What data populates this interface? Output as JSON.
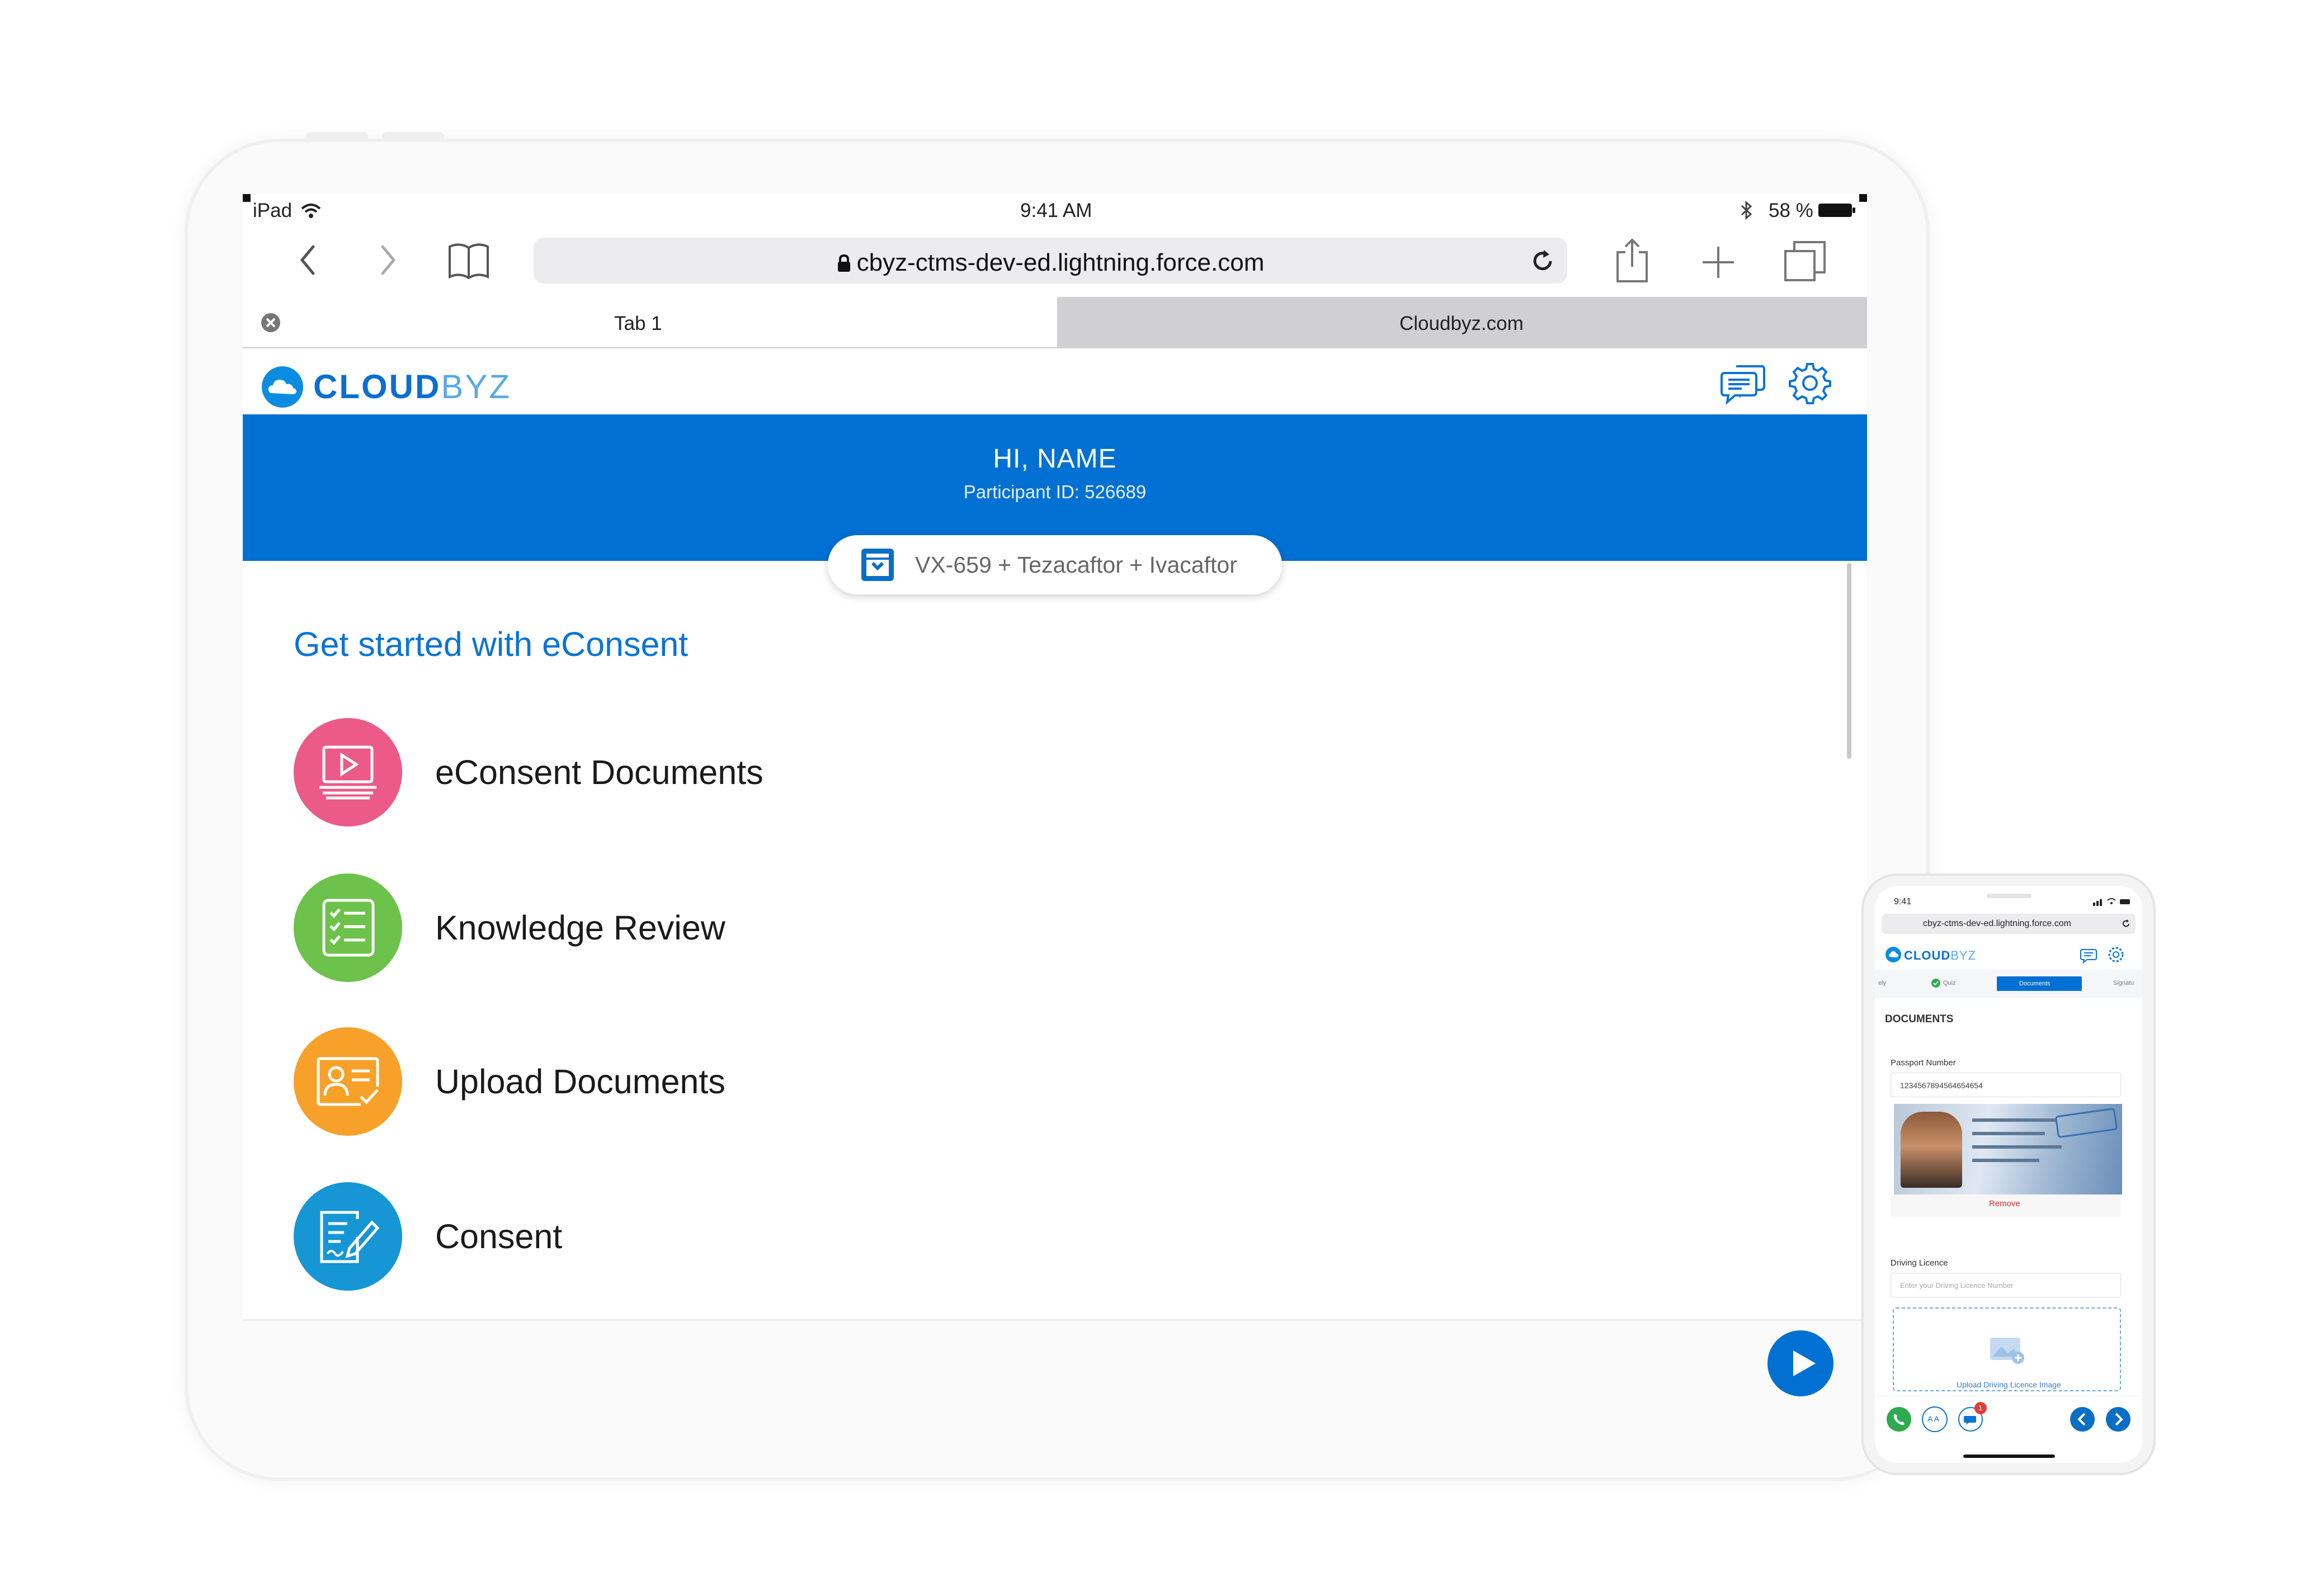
{
  "status_bar": {
    "device": "iPad",
    "time": "9:41 AM",
    "battery": "58 %"
  },
  "browser": {
    "url": "cbyz-ctms-dev-ed.lightning.force.com",
    "tabs": [
      {
        "label": "Tab 1"
      },
      {
        "label": "Cloudbyz.com"
      }
    ]
  },
  "app": {
    "logo_bold": "CLOUD",
    "logo_light": "BYZ",
    "greeting": "HI, NAME",
    "participant_id": "Participant ID: 526689",
    "study": "VX-659 + Tezacaftor + Ivacaftor",
    "section_title": "Get started with eConsent",
    "items": [
      {
        "label": "eConsent Documents",
        "color": "#ec5a8a",
        "icon": "video-document-icon"
      },
      {
        "label": "Knowledge Review",
        "color": "#6cc24a",
        "icon": "checklist-icon"
      },
      {
        "label": "Upload Documents",
        "color": "#f7a12a",
        "icon": "id-card-icon"
      },
      {
        "label": "Consent",
        "color": "#1696d4",
        "icon": "sign-document-icon"
      }
    ]
  },
  "phone": {
    "time": "9:41",
    "url": "cbyz-ctms-dev-ed.lightning.force.com",
    "logo_bold": "CLOUD",
    "logo_light": "BYZ",
    "steps": [
      "ely",
      "Quiz",
      "Documents",
      "Signatu"
    ],
    "section": "DOCUMENTS",
    "passport_label": "Passport Number",
    "passport_value": "1234567894564654654",
    "remove": "Remove",
    "licence_label": "Driving Licence",
    "licence_placeholder": "Enter your Driving Licence Number",
    "upload_text": "Upload Driving Licence Image",
    "badge": "1",
    "text_size": "A A"
  },
  "colors": {
    "brand_blue": "#0070d2",
    "link_blue": "#0a74d6"
  }
}
